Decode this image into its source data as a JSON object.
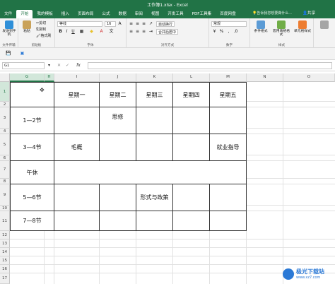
{
  "window": {
    "title": "工作簿1.xlsx - Excel",
    "tell_me": "告诉我您想要做什么...",
    "share": "共享"
  },
  "tabs": [
    "文件",
    "开始",
    "我的模板",
    "插入",
    "页面布局",
    "公式",
    "数据",
    "审阅",
    "视图",
    "开发工具",
    "PDF工具集",
    "百度网盘"
  ],
  "active_tab": "开始",
  "ribbon": {
    "groups": {
      "file_transfer": "文件传输",
      "clipboard": "剪贴板",
      "font": "字体",
      "alignment": "对齐方式",
      "number": "数字",
      "styles": "样式"
    },
    "send_label": "发送到手机",
    "paste_label": "粘贴",
    "cut_label": "剪切",
    "copy_label": "复制",
    "format_painter_label": "格式刷",
    "font_name": "等线",
    "font_size": "16",
    "wrap_text": "自动换行",
    "merge_center": "合并后居中",
    "number_format": "常规",
    "cond_format": "条件格式",
    "table_format": "套用表格格式",
    "cell_style": "单元格样式"
  },
  "formula_bar": {
    "name_box": "G1",
    "fx": "fx",
    "formula": ""
  },
  "columns": [
    "G",
    "H",
    "I",
    "J",
    "K",
    "L",
    "M",
    "N",
    "O"
  ],
  "rows": [
    "1",
    "2",
    "3",
    "4",
    "5",
    "6",
    "7",
    "8",
    "9",
    "10",
    "11",
    "12",
    "13",
    "14",
    "15",
    "16",
    "17"
  ],
  "table": {
    "headers": [
      "星期一",
      "星期二",
      "星期三",
      "星期四",
      "星期五"
    ],
    "periods": [
      "1—2节",
      "3—4节",
      "午休",
      "5—6节",
      "7—8节"
    ],
    "cells": {
      "r1_tue": "思修",
      "r2_mon": "毛概",
      "r2_fri": "就业指导",
      "r4_wed": "形式与政策"
    }
  },
  "watermark": {
    "brand": "极光下载站",
    "url": "www.xz7.com"
  },
  "colors": {
    "excel_green": "#217346",
    "ribbon_bg": "#f3f3f3"
  }
}
